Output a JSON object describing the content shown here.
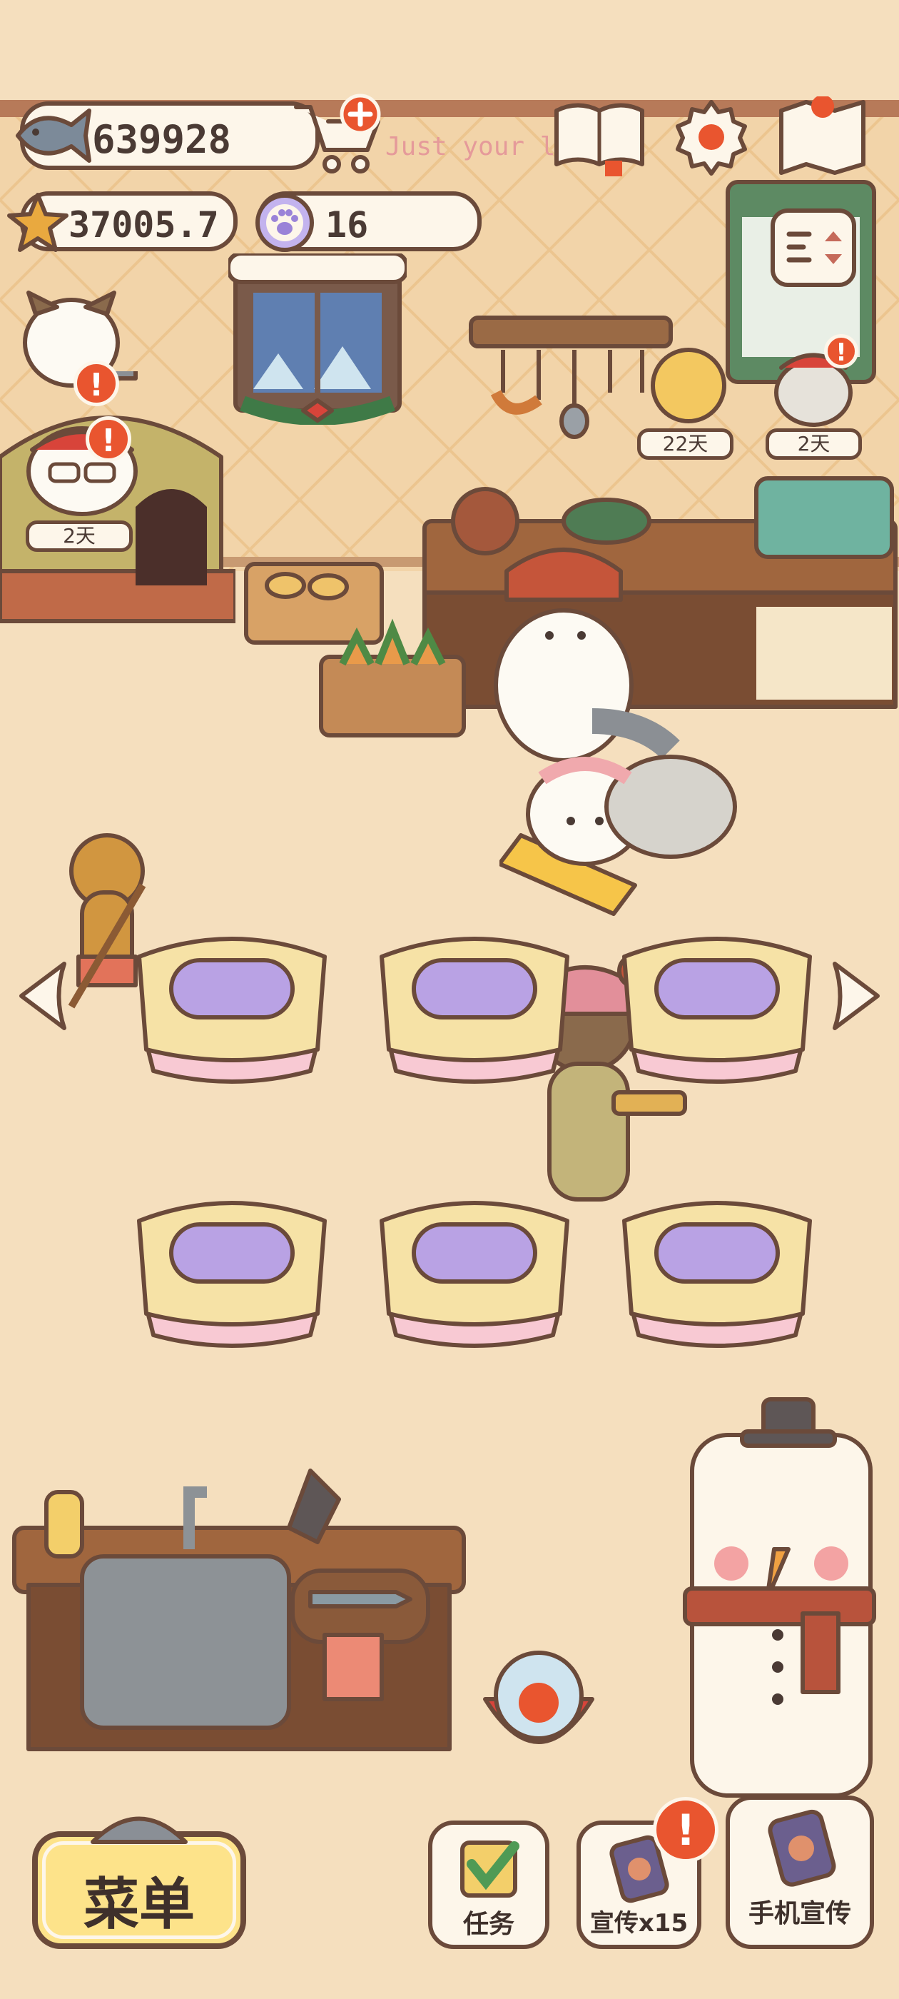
{
  "hud": {
    "fish_currency": "639928",
    "star_currency": "37005.7",
    "paw_currency": "16",
    "sign_text": "Just your lo"
  },
  "timers": {
    "cat_oven": "2天",
    "cat_shelf_1": "22天",
    "cat_shelf_2": "2天"
  },
  "bottom_bar": {
    "menu_label": "菜单",
    "task_label": "任务",
    "promote_label": "宣传x15",
    "phone_promote_label": "手机宣传"
  },
  "colors": {
    "background": "#f5dfbe",
    "outline": "#6b4a3a",
    "badge": "#e9552f",
    "menu_button": "#fde38a",
    "table_cloth": "#f8c9d3",
    "cushion": "#b9a2e4"
  },
  "icons": [
    "fish-icon",
    "cart-add-icon",
    "star-icon",
    "paw-icon",
    "book-icon",
    "gear-icon",
    "map-icon",
    "filter-icon",
    "arrow-left-icon",
    "arrow-right-icon",
    "check-icon",
    "phone-icon"
  ]
}
